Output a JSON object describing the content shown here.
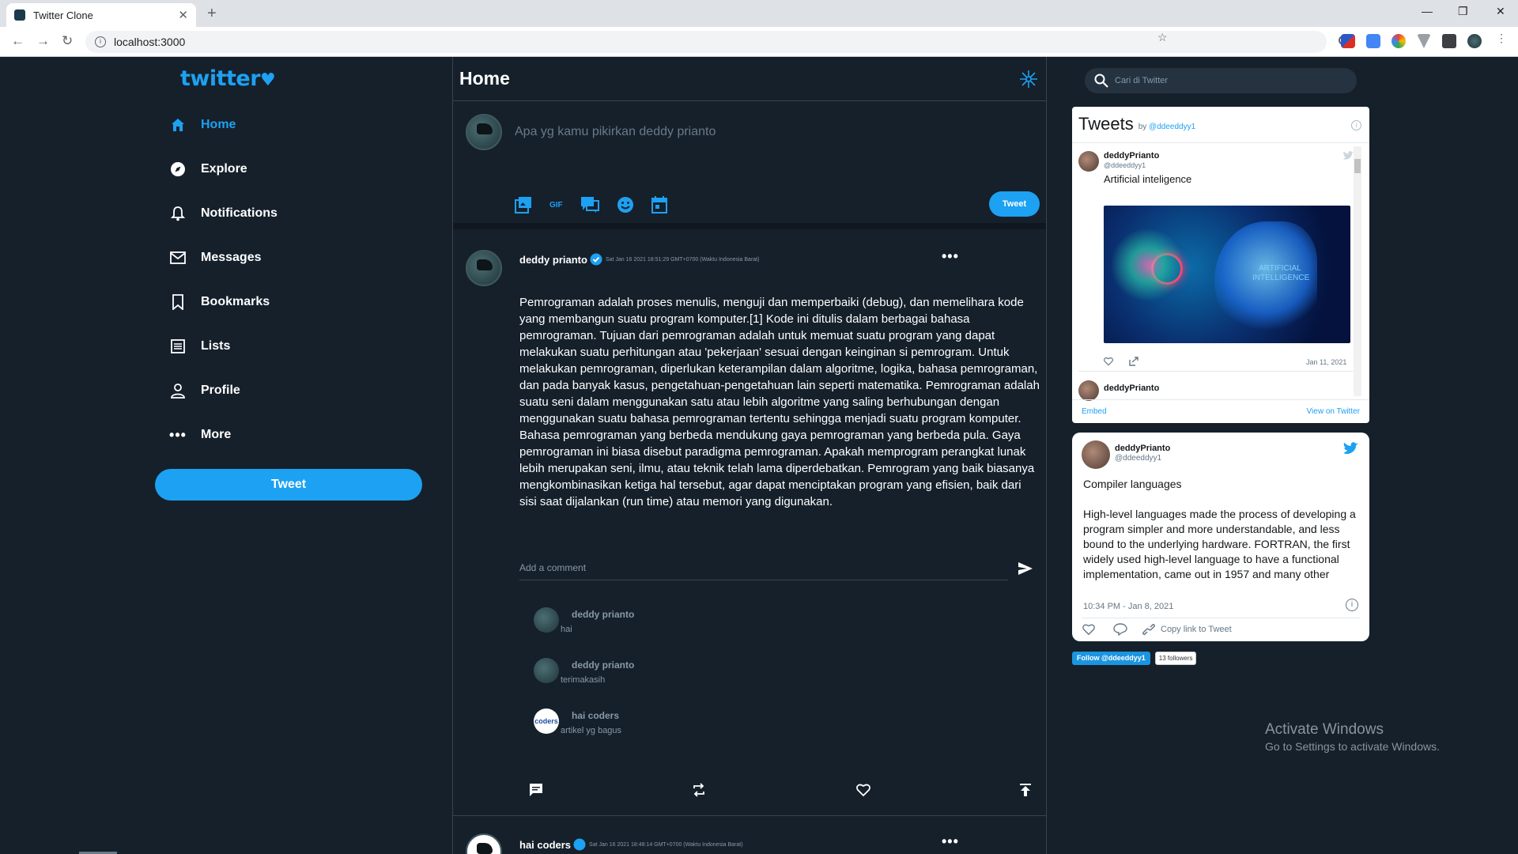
{
  "browser": {
    "tab_title": "Twitter Clone",
    "tab_close": "✕",
    "new_tab": "+",
    "url": "localhost:3000"
  },
  "sidebar": {
    "logo": "twitter",
    "items": [
      {
        "label": "Home",
        "icon": "home-icon"
      },
      {
        "label": "Explore",
        "icon": "compass-icon"
      },
      {
        "label": "Notifications",
        "icon": "bell-icon"
      },
      {
        "label": "Messages",
        "icon": "mail-icon"
      },
      {
        "label": "Bookmarks",
        "icon": "bookmark-icon"
      },
      {
        "label": "Lists",
        "icon": "list-icon"
      },
      {
        "label": "Profile",
        "icon": "person-icon"
      },
      {
        "label": "More",
        "icon": "more-icon"
      }
    ],
    "tweet_button": "Tweet"
  },
  "main": {
    "title": "Home",
    "composer": {
      "placeholder": "Apa yg kamu pikirkan deddy prianto",
      "gif_label": "GIF",
      "tweet_button": "Tweet"
    },
    "post": {
      "name": "deddy prianto",
      "date": "Sat Jan 16 2021 18:51:29 GMT+0700 (Waktu Indonesia Barat)",
      "body": "Pemrograman adalah proses menulis, menguji dan memperbaiki (debug), dan memelihara kode yang membangun suatu program komputer.[1] Kode ini ditulis dalam berbagai bahasa pemrograman. Tujuan dari pemrograman adalah untuk memuat suatu program yang dapat melakukan suatu perhitungan atau 'pekerjaan' sesuai dengan keinginan si pemrogram. Untuk melakukan pemrograman, diperlukan keterampilan dalam algoritme, logika, bahasa pemrograman, dan pada banyak kasus, pengetahuan-pengetahuan lain seperti matematika. Pemrograman adalah suatu seni dalam menggunakan satu atau lebih algoritme yang saling berhubungan dengan menggunakan suatu bahasa pemrograman tertentu sehingga menjadi suatu program komputer. Bahasa pemrograman yang berbeda mendukung gaya pemrograman yang berbeda pula. Gaya pemrograman ini biasa disebut paradigma pemrograman. Apakah memprogram perangkat lunak lebih merupakan seni, ilmu, atau teknik telah lama diperdebatkan. Pemrogram yang baik biasanya mengkombinasikan ketiga hal tersebut, agar dapat menciptakan program yang efisien, baik dari sisi saat dijalankan (run time) atau memori yang digunakan.",
      "comment_placeholder": "Add a comment",
      "comments": [
        {
          "name": "deddy prianto",
          "text": "hai"
        },
        {
          "name": "deddy prianto",
          "text": "terimakasih"
        },
        {
          "name": "hai coders",
          "text": "artikel yg bagus",
          "avatar_text": "coders"
        }
      ]
    },
    "next_post": {
      "name": "hai coders",
      "date": "Sat Jan 16 2021 18:48:14 GMT+0700 (Waktu Indonesia Barat)"
    }
  },
  "right": {
    "search_placeholder": "Cari di Twitter",
    "timeline": {
      "title": "Tweets",
      "by": "by",
      "handle_link": "@ddeeddyy1",
      "tweet": {
        "name": "deddyPrianto",
        "handle": "@ddeeddyy1",
        "text": "Artificial inteligence",
        "image_text_1": "ARTIFICIAL",
        "image_text_2": "INTELLIGENCE",
        "date": "Jan 11, 2021"
      },
      "next_name": "deddyPrianto",
      "embed": "Embed",
      "view": "View on Twitter"
    },
    "card": {
      "name": "deddyPrianto",
      "handle": "@ddeeddyy1",
      "title": "Compiler languages",
      "body": "High-level languages made the process of developing a program simpler and more understandable, and less bound to the underlying hardware. FORTRAN, the first widely used high-level language to have a functional implementation, came out in 1957 and many other",
      "time": "10:34 PM - Jan 8, 2021",
      "copy_link": "Copy link to Tweet"
    },
    "follow": {
      "button": "Follow @ddeeddyy1",
      "count": "13 followers"
    }
  },
  "system": {
    "activate_title": "Activate Windows",
    "activate_sub": "Go to Settings to activate Windows."
  },
  "colors": {
    "accent": "#1da1f2",
    "background": "#15202b",
    "border": "#38444d"
  }
}
